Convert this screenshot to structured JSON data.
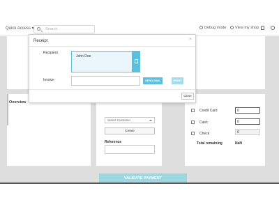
{
  "navbar": {
    "quick_access": "Quick Access ▾",
    "search_placeholder": "Search",
    "debug_mode": "Debug mode",
    "view_shop": "View my shop",
    "icons": [
      "search-icon",
      "debug-icon",
      "shop-icon",
      "bell-icon",
      "gear-icon"
    ]
  },
  "left_panel": {
    "title": "Overview"
  },
  "customer": {
    "select_value": "Select Customer",
    "create_label": "Create",
    "reference_label": "Reference",
    "reference_value": ""
  },
  "payment": {
    "methods": [
      {
        "label": "Credit Card",
        "value": "0",
        "checked": false
      },
      {
        "label": "Cash",
        "value": "0",
        "checked": false
      },
      {
        "label": "Check",
        "value": "0",
        "checked": false
      }
    ],
    "total_label": "Total remaining",
    "total_value": "NaN",
    "validate_label": "VALIDATE PAYMENT"
  },
  "modal": {
    "title": "Receipt",
    "close_icon": "×",
    "recipient_label": "Recipient",
    "recipient_value": "John Doe",
    "invoice_label": "Invoice",
    "invoice_value": "",
    "send_mail_label": "SEND MAIL",
    "print_label": "PRINT",
    "close_label": "Close"
  },
  "colors": {
    "accent": "#5bc0de",
    "accent_light": "#a7dced",
    "validate": "#9bd6e1",
    "backdrop": "#dedede"
  }
}
